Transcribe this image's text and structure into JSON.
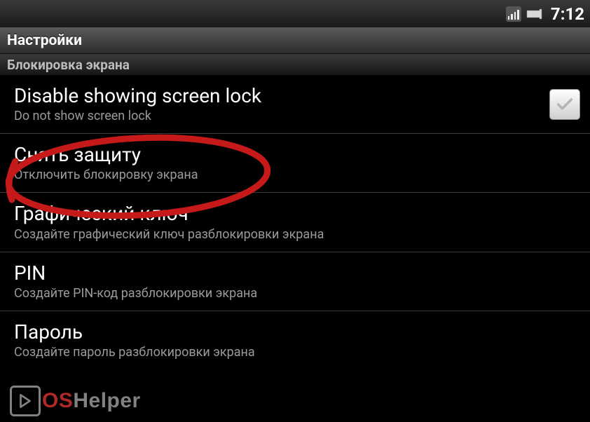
{
  "status": {
    "time": "7:12"
  },
  "title": "Настройки",
  "section": "Блокировка экрана",
  "items": [
    {
      "title": "Disable showing screen lock",
      "subtitle": "Do not show screen lock",
      "hasCheckbox": true
    },
    {
      "title": "Снять защиту",
      "subtitle": "Отключить блокировку экрана"
    },
    {
      "title": "Графический ключ",
      "subtitle": "Создайте графический ключ разблокировки экрана"
    },
    {
      "title": "PIN",
      "subtitle": "Создайте PIN-код разблокировки экрана"
    },
    {
      "title": "Пароль",
      "subtitle": "Создайте пароль разблокировки экрана"
    }
  ],
  "watermark": {
    "part1": "OS",
    "part2": "Helper"
  }
}
